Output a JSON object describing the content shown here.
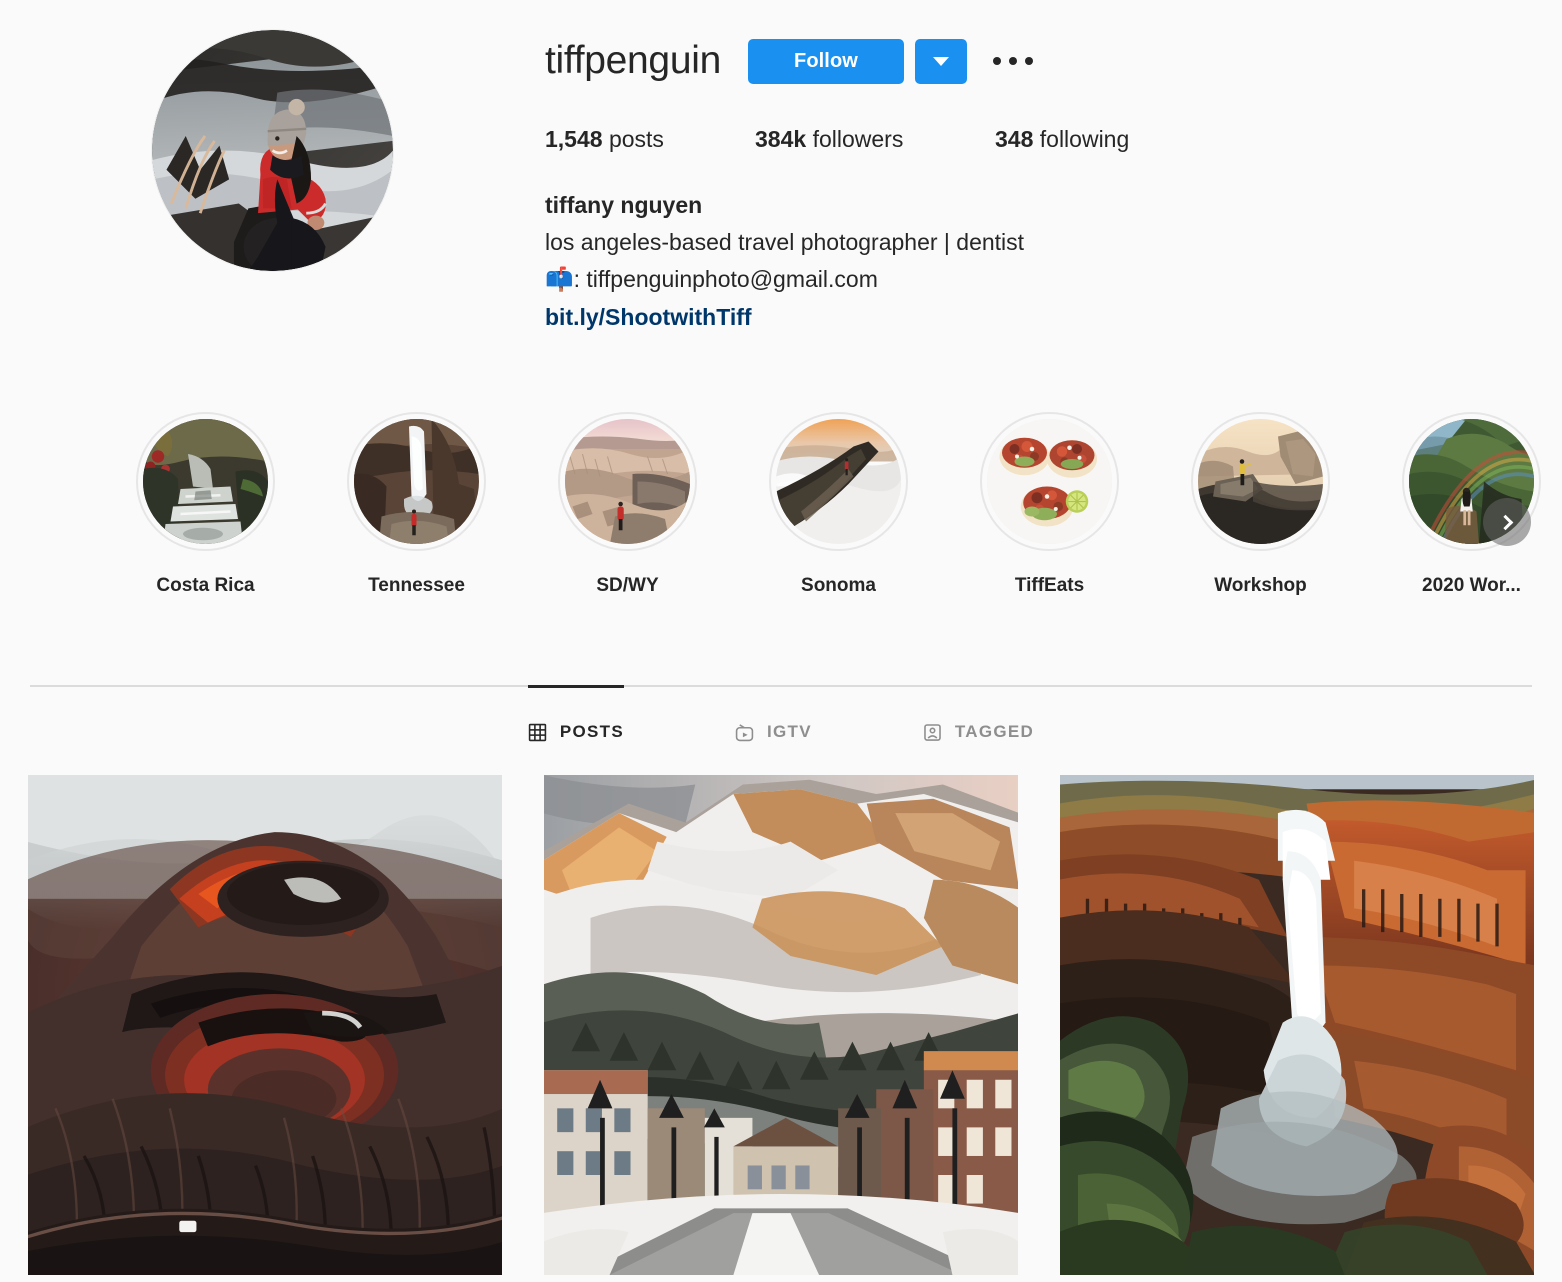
{
  "profile": {
    "username": "tiffpenguin",
    "follow_label": "Follow",
    "options_icon": "ellipsis-icon",
    "dropdown_icon": "chevron-down-icon",
    "avatar_alt": "woman in red jacket and gray beanie sitting on rocks beside an icy stream",
    "stats": {
      "posts_count": "1,548",
      "posts_label": "posts",
      "followers_count": "384k",
      "followers_label": "followers",
      "following_count": "348",
      "following_label": "following"
    },
    "bio": {
      "full_name": "tiffany nguyen",
      "line1": "los angeles-based travel photographer | dentist",
      "email_emoji": "📫",
      "email_line": ": tiffpenguinphoto@gmail.com",
      "link": "bit.ly/ShootwithTiff"
    }
  },
  "highlights": {
    "next_icon": "chevron-right-icon",
    "items": [
      {
        "label": "Costa Rica",
        "alt": "jungle stream cascading over rock ledges with tropical foliage"
      },
      {
        "label": "Tennessee",
        "alt": "tall thin waterfall into a rock amphitheater with a person in red"
      },
      {
        "label": "SD/WY",
        "alt": "badlands ridges at sunset with a person in a red jacket"
      },
      {
        "label": "Sonoma",
        "alt": "dark ridge line above a sea of clouds at sunrise"
      },
      {
        "label": "TiffEats",
        "alt": "three tacos with avocado and salsa on a white plate with lime"
      },
      {
        "label": "Workshop",
        "alt": "person in yellow jacket on a granite overlook at golden hour"
      },
      {
        "label": "2020 Wor...",
        "alt": "green mountain ridge with a rainbow and woman in white dress"
      }
    ]
  },
  "tabs": [
    {
      "label": "POSTS",
      "icon": "grid-icon",
      "active": true
    },
    {
      "label": "IGTV",
      "icon": "igtv-icon",
      "active": false
    },
    {
      "label": "TAGGED",
      "icon": "tagged-icon",
      "active": false
    }
  ],
  "posts": [
    {
      "alt": "aerial view of a dark volcanic crater glowing red with mist and a white vehicle on the road below"
    },
    {
      "alt": "snowy mountain town main street with alpenglow lighting the jagged peak above"
    },
    {
      "alt": "tall waterfall plunging into a red-orange canyon with mossy green cliffs"
    }
  ],
  "colors": {
    "accent": "#1a90f0",
    "background": "#fafafa",
    "text": "#262626",
    "muted": "#8e8e8e",
    "link": "#00376b",
    "divider": "#dbdbdb"
  }
}
